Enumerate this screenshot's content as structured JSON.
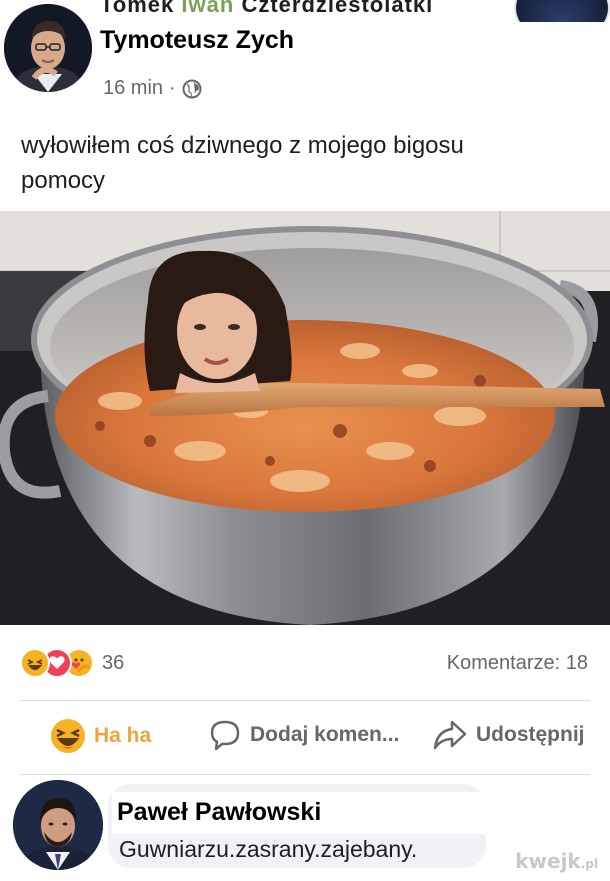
{
  "top_strip": {
    "cut_text_a": "Tomek",
    "cut_text_b": "Iwan",
    "cut_text_c": "Czterdziestolatki"
  },
  "post": {
    "author_name": "Tymoteusz Zych",
    "time": "16 min",
    "separator": "·",
    "privacy_icon": "globe-icon",
    "text_line1": "wyłowiłem coś dziwnego z mojego bigosu",
    "text_line2": "pomocy"
  },
  "stats": {
    "reaction_icons": [
      "haha-icon",
      "love-icon",
      "care-icon"
    ],
    "reaction_count": "36",
    "comments_label": "Komentarze: 18"
  },
  "actions": {
    "haha_label": "Ha ha",
    "comment_label": "Dodaj komen...",
    "share_label": "Udostępnij"
  },
  "comment": {
    "author_name": "Paweł Pawłowski",
    "text": "Guwniarzu.zasrany.zajebany."
  },
  "watermark": {
    "brand": "kwejk",
    "tld": ".pl"
  },
  "colors": {
    "haha": "#f7b125",
    "love": "#f33e58",
    "muted": "#65676b",
    "bubble": "#f0f2f5"
  }
}
